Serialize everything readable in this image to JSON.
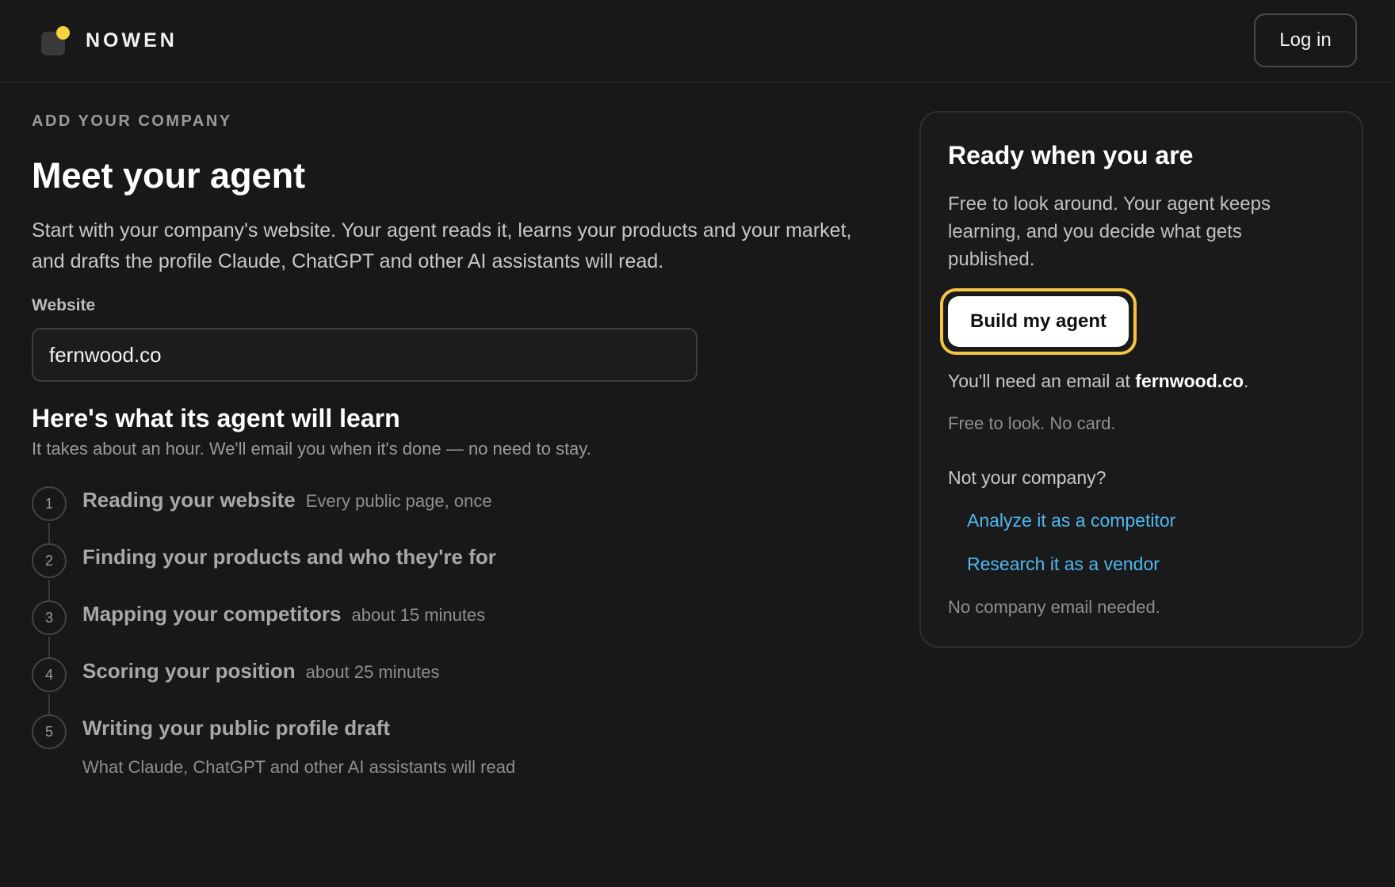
{
  "header": {
    "brand": "NOWEN",
    "login_label": "Log in"
  },
  "main": {
    "eyebrow": "ADD YOUR COMPANY",
    "title": "Meet your agent",
    "intro": "Start with your company's website. Your agent reads it, learns your products and your market, and drafts the profile Claude, ChatGPT and other AI assistants will read.",
    "website_label": "Website",
    "website_value": "fernwood.co",
    "learn_title": "Here's what its agent will learn",
    "learn_sub": "It takes about an hour. We'll email you when it's done — no need to stay.",
    "steps": [
      {
        "num": "1",
        "title": "Reading your website",
        "note": "Every public page, once"
      },
      {
        "num": "2",
        "title": "Finding your products and who they're for",
        "note": ""
      },
      {
        "num": "3",
        "title": "Mapping your competitors",
        "note": "about 15 minutes"
      },
      {
        "num": "4",
        "title": "Scoring your position",
        "note": "about 25 minutes"
      },
      {
        "num": "5",
        "title": "Writing your public profile draft",
        "subnote": "What Claude, ChatGPT and other AI assistants will read"
      }
    ]
  },
  "card": {
    "title": "Ready when you are",
    "text": "Free to look around. Your agent keeps learning, and you decide what gets published.",
    "build_label": "Build my agent",
    "email_prefix": "You'll need an email at ",
    "email_domain": "fernwood.co",
    "email_suffix": ".",
    "free_note": "Free to look. No card.",
    "not_company": "Not your company?",
    "link_competitor": "Analyze it as a competitor",
    "link_vendor": "Research it as a vendor",
    "no_email": "No company email needed."
  },
  "colors": {
    "background": "#181818",
    "accent_yellow": "#f5c542",
    "link_blue": "#4fb8f0"
  }
}
